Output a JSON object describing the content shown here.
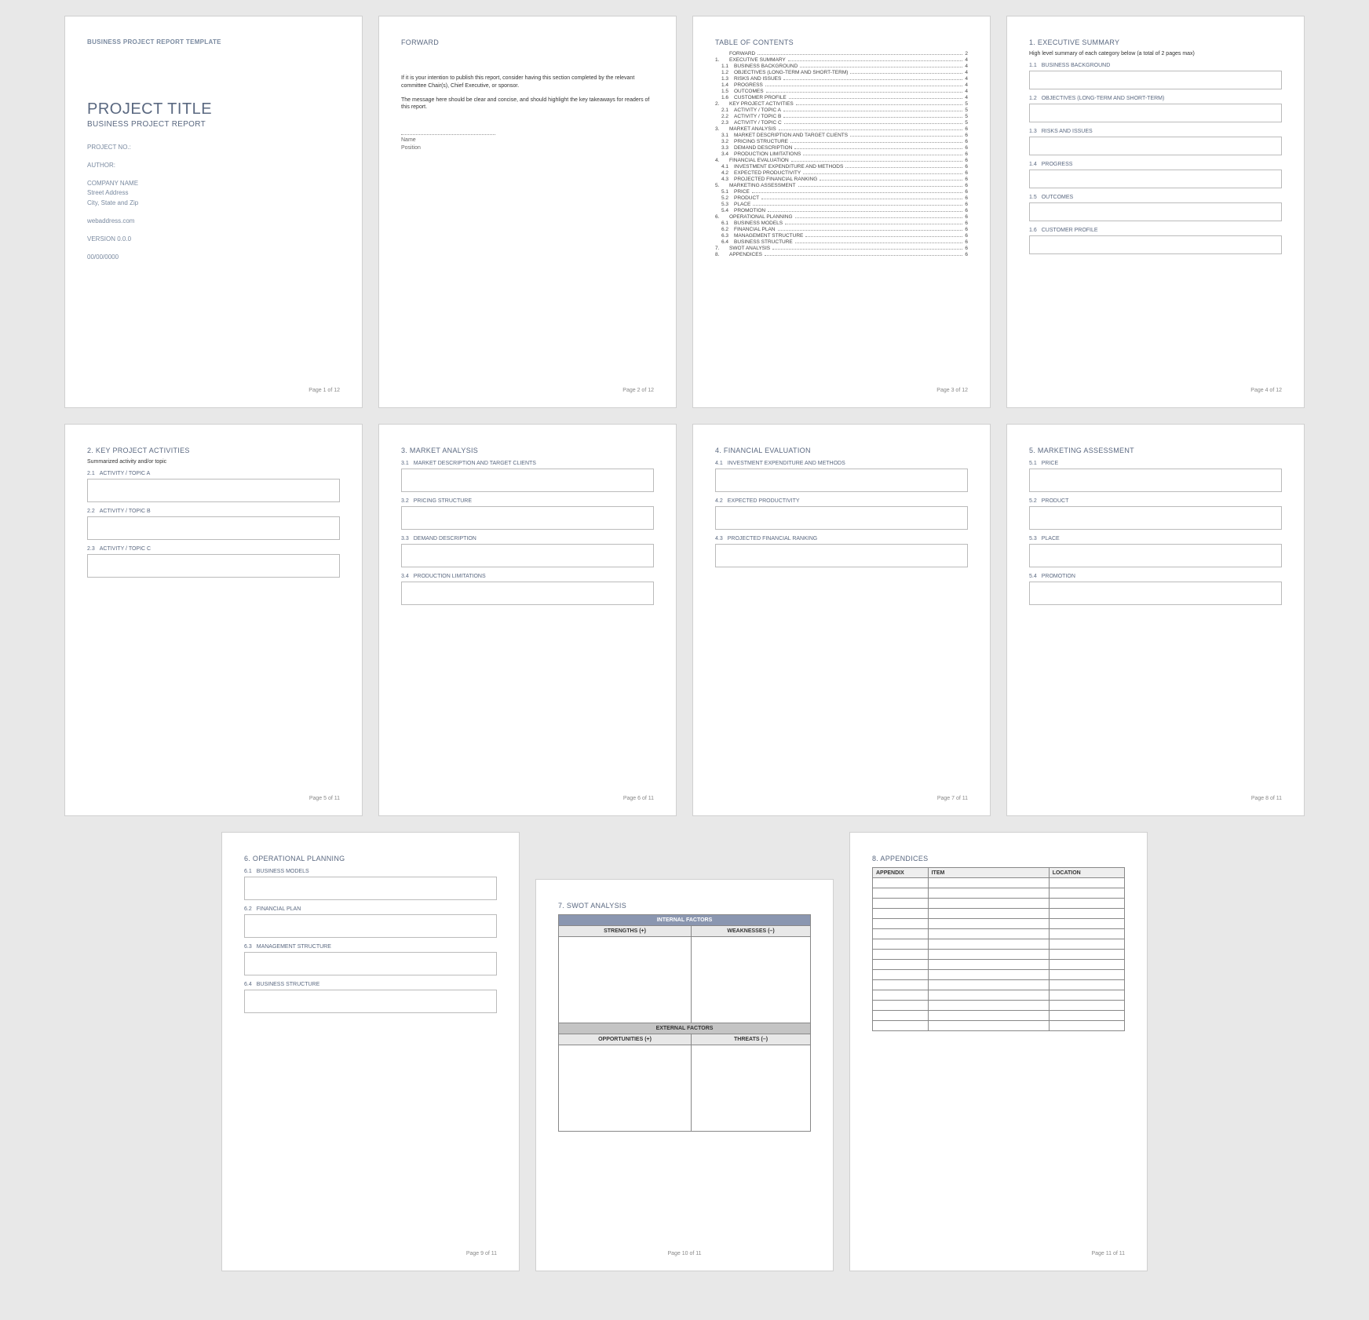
{
  "doc": {
    "template_header": "BUSINESS PROJECT REPORT TEMPLATE",
    "project_title": "PROJECT TITLE",
    "project_subtitle": "BUSINESS PROJECT REPORT",
    "project_no_label": "PROJECT NO.:",
    "author_label": "AUTHOR:",
    "company_name": "COMPANY NAME",
    "street": "Street Address",
    "city": "City, State and Zip",
    "web": "webaddress.com",
    "version": "VERSION 0.0.0",
    "date": "00/00/0000"
  },
  "forward": {
    "title": "FORWARD",
    "para1": "If it is your intention to publish this report, consider having this section completed by the relevant committee Chair(s), Chief Executive, or sponsor.",
    "para2": "The message here should be clear and concise, and should highlight the key takeaways for readers of this report.",
    "name_label": "Name",
    "position_label": "Position"
  },
  "toc": {
    "title": "TABLE OF CONTENTS",
    "rows": [
      {
        "n": "",
        "t": "FORWARD",
        "p": "2",
        "sub": false
      },
      {
        "n": "1.",
        "t": "EXECUTIVE SUMMARY",
        "p": "4",
        "sub": false
      },
      {
        "n": "1.1",
        "t": "BUSINESS BACKGROUND",
        "p": "4",
        "sub": true
      },
      {
        "n": "1.2",
        "t": "OBJECTIVES (LONG-TERM AND SHORT-TERM)",
        "p": "4",
        "sub": true
      },
      {
        "n": "1.3",
        "t": "RISKS AND ISSUES",
        "p": "4",
        "sub": true
      },
      {
        "n": "1.4",
        "t": "PROGRESS",
        "p": "4",
        "sub": true
      },
      {
        "n": "1.5",
        "t": "OUTCOMES",
        "p": "4",
        "sub": true
      },
      {
        "n": "1.6",
        "t": "CUSTOMER PROFILE",
        "p": "4",
        "sub": true
      },
      {
        "n": "2.",
        "t": "KEY PROJECT ACTIVITIES",
        "p": "5",
        "sub": false
      },
      {
        "n": "2.1",
        "t": "ACTIVITY / TOPIC A",
        "p": "5",
        "sub": true
      },
      {
        "n": "2.2",
        "t": "ACTIVITY / TOPIC B",
        "p": "5",
        "sub": true
      },
      {
        "n": "2.3",
        "t": "ACTIVITY / TOPIC C",
        "p": "5",
        "sub": true
      },
      {
        "n": "3.",
        "t": "MARKET ANALYSIS",
        "p": "6",
        "sub": false
      },
      {
        "n": "3.1",
        "t": "MARKET DESCRIPTION AND TARGET CLIENTS",
        "p": "6",
        "sub": true
      },
      {
        "n": "3.2",
        "t": "PRICING STRUCTURE",
        "p": "6",
        "sub": true
      },
      {
        "n": "3.3",
        "t": "DEMAND DESCRIPTION",
        "p": "6",
        "sub": true
      },
      {
        "n": "3.4",
        "t": "PRODUCTION LIMITATIONS",
        "p": "6",
        "sub": true
      },
      {
        "n": "4.",
        "t": "FINANCIAL EVALUATION",
        "p": "6",
        "sub": false
      },
      {
        "n": "4.1",
        "t": "INVESTMENT EXPENDITURE AND METHODS",
        "p": "6",
        "sub": true
      },
      {
        "n": "4.2",
        "t": "EXPECTED PRODUCTIVITY",
        "p": "6",
        "sub": true
      },
      {
        "n": "4.3",
        "t": "PROJECTED FINANCIAL RANKING",
        "p": "6",
        "sub": true
      },
      {
        "n": "5.",
        "t": "MARKETING ASSESSMENT",
        "p": "6",
        "sub": false
      },
      {
        "n": "5.1",
        "t": "PRICE",
        "p": "6",
        "sub": true
      },
      {
        "n": "5.2",
        "t": "PRODUCT",
        "p": "6",
        "sub": true
      },
      {
        "n": "5.3",
        "t": "PLACE",
        "p": "6",
        "sub": true
      },
      {
        "n": "5.4",
        "t": "PROMOTION",
        "p": "6",
        "sub": true
      },
      {
        "n": "6.",
        "t": "OPERATIONAL PLANNING",
        "p": "6",
        "sub": false
      },
      {
        "n": "6.1",
        "t": "BUSINESS MODELS",
        "p": "6",
        "sub": true
      },
      {
        "n": "6.2",
        "t": "FINANCIAL PLAN",
        "p": "6",
        "sub": true
      },
      {
        "n": "6.3",
        "t": "MANAGEMENT STRUCTURE",
        "p": "6",
        "sub": true
      },
      {
        "n": "6.4",
        "t": "BUSINESS STRUCTURE",
        "p": "6",
        "sub": true
      },
      {
        "n": "7.",
        "t": "SWOT ANALYSIS",
        "p": "6",
        "sub": false
      },
      {
        "n": "8.",
        "t": "APPENDICES",
        "p": "6",
        "sub": false
      }
    ]
  },
  "p4": {
    "title": "1. EXECUTIVE SUMMARY",
    "note": "High level summary of each category below (a total of 2 pages max)",
    "subs": [
      {
        "n": "1.1",
        "t": "BUSINESS BACKGROUND"
      },
      {
        "n": "1.2",
        "t": "OBJECTIVES (LONG-TERM AND SHORT-TERM)"
      },
      {
        "n": "1.3",
        "t": "RISKS AND ISSUES"
      },
      {
        "n": "1.4",
        "t": "PROGRESS"
      },
      {
        "n": "1.5",
        "t": "OUTCOMES"
      },
      {
        "n": "1.6",
        "t": "CUSTOMER PROFILE"
      }
    ]
  },
  "p5": {
    "title": "2. KEY PROJECT ACTIVITIES",
    "note": "Summarized activity and/or topic",
    "subs": [
      {
        "n": "2.1",
        "t": "ACTIVITY / TOPIC A"
      },
      {
        "n": "2.2",
        "t": "ACTIVITY / TOPIC B"
      },
      {
        "n": "2.3",
        "t": "ACTIVITY / TOPIC C"
      }
    ]
  },
  "p6": {
    "title": "3. MARKET ANALYSIS",
    "subs": [
      {
        "n": "3.1",
        "t": "MARKET DESCRIPTION AND TARGET CLIENTS"
      },
      {
        "n": "3.2",
        "t": "PRICING STRUCTURE"
      },
      {
        "n": "3.3",
        "t": "DEMAND DESCRIPTION"
      },
      {
        "n": "3.4",
        "t": "PRODUCTION LIMITATIONS"
      }
    ]
  },
  "p7": {
    "title": "4. FINANCIAL EVALUATION",
    "subs": [
      {
        "n": "4.1",
        "t": "INVESTMENT EXPENDITURE AND METHODS"
      },
      {
        "n": "4.2",
        "t": "EXPECTED PRODUCTIVITY"
      },
      {
        "n": "4.3",
        "t": "PROJECTED FINANCIAL RANKING"
      }
    ]
  },
  "p8": {
    "title": "5. MARKETING ASSESSMENT",
    "subs": [
      {
        "n": "5.1",
        "t": "PRICE"
      },
      {
        "n": "5.2",
        "t": "PRODUCT"
      },
      {
        "n": "5.3",
        "t": "PLACE"
      },
      {
        "n": "5.4",
        "t": "PROMOTION"
      }
    ]
  },
  "p9": {
    "title": "6. OPERATIONAL PLANNING",
    "subs": [
      {
        "n": "6.1",
        "t": "BUSINESS MODELS"
      },
      {
        "n": "6.2",
        "t": "FINANCIAL PLAN"
      },
      {
        "n": "6.3",
        "t": "MANAGEMENT STRUCTURE"
      },
      {
        "n": "6.4",
        "t": "BUSINESS STRUCTURE"
      }
    ]
  },
  "p10": {
    "title": "7. SWOT ANALYSIS",
    "internal": "INTERNAL FACTORS",
    "external": "EXTERNAL FACTORS",
    "strengths": "STRENGTHS (+)",
    "weaknesses": "WEAKNESSES (–)",
    "opportunities": "OPPORTUNITIES (+)",
    "threats": "THREATS (–)"
  },
  "p11": {
    "title": "8. APPENDICES",
    "cols": [
      "APPENDIX",
      "ITEM",
      "LOCATION"
    ],
    "rows": 15
  },
  "footers": {
    "p1": "Page 1 of 12",
    "p2": "Page 2 of 12",
    "p3": "Page 3 of 12",
    "p4": "Page 4 of 12",
    "p5": "Page 5 of 11",
    "p6": "Page 6 of 11",
    "p7": "Page 7 of 11",
    "p8": "Page 8 of 11",
    "p9": "Page 9 of 11",
    "p10": "Page 10 of 11",
    "p11": "Page 11 of 11"
  }
}
